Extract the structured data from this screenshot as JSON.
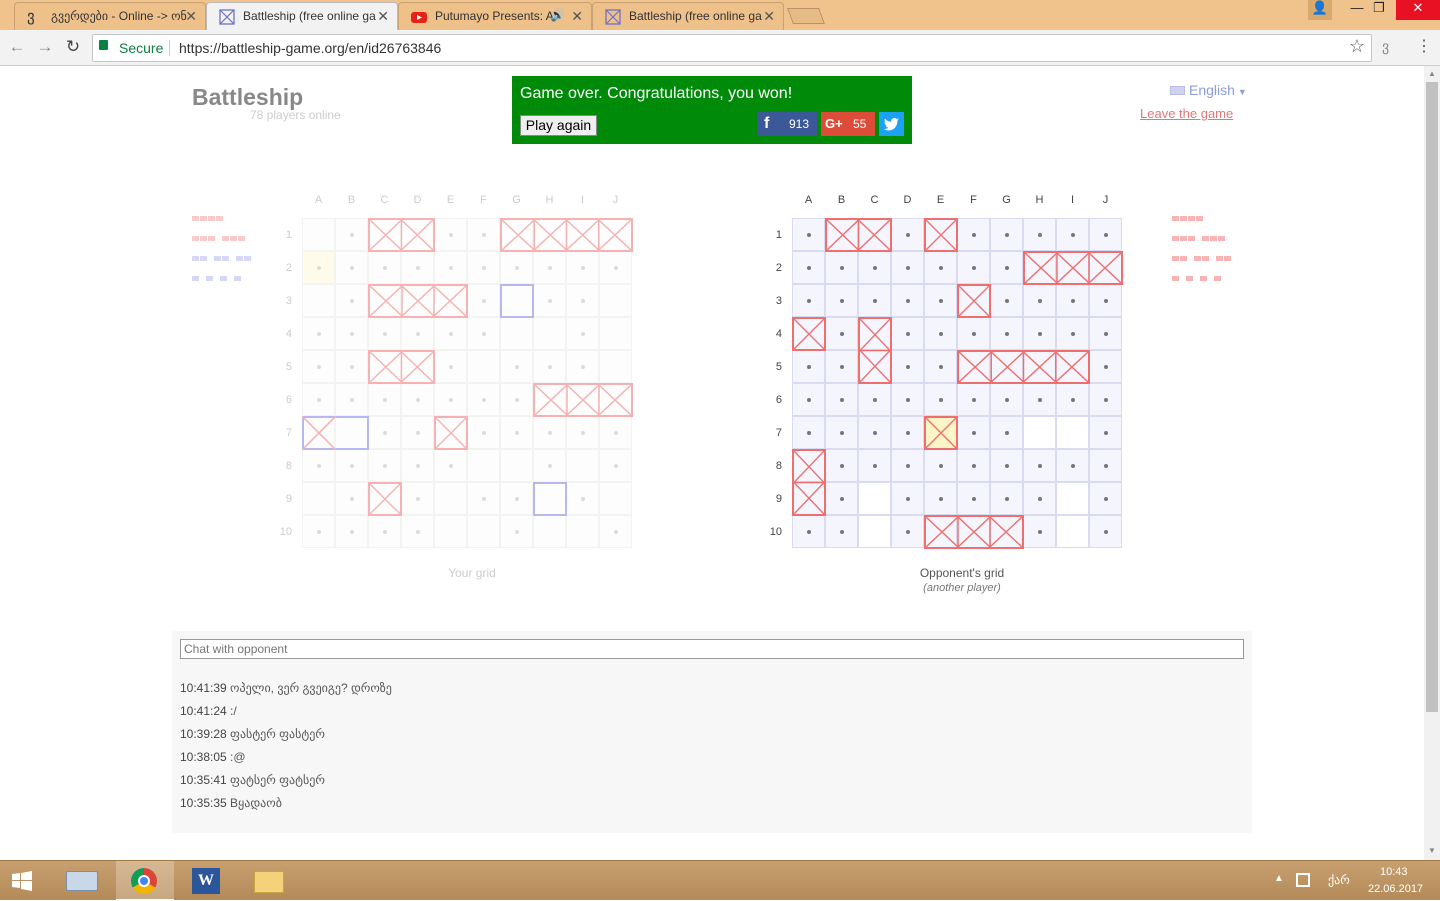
{
  "browser": {
    "tabs": [
      {
        "title": "გვერდები - Online -> ონ",
        "favicon": "georgian-letter-icon",
        "active": false
      },
      {
        "title": "Battleship (free online ga",
        "favicon": "battleship-icon",
        "active": true
      },
      {
        "title": "Putumayo Presents: A",
        "favicon": "youtube-icon",
        "active": false,
        "audio": true
      },
      {
        "title": "Battleship (free online ga",
        "favicon": "battleship-icon",
        "active": false
      }
    ],
    "secure_label": "Secure",
    "url": "https://battleship-game.org/en/id26763846"
  },
  "header": {
    "logo": "Battleship",
    "players_online": "78 players online",
    "language": "English",
    "leave_link": "Leave the game"
  },
  "banner": {
    "message": "Game over. Congratulations, you won!",
    "play_again": "Play again",
    "facebook_count": "913",
    "gplus_count": "55",
    "gplus_label": "G+"
  },
  "columns": [
    "A",
    "B",
    "C",
    "D",
    "E",
    "F",
    "G",
    "H",
    "I",
    "J"
  ],
  "rows": [
    "1",
    "2",
    "3",
    "4",
    "5",
    "6",
    "7",
    "8",
    "9",
    "10"
  ],
  "your_grid": {
    "caption": "Your grid",
    "hits": [
      [
        "C1",
        "D1"
      ],
      [
        "G1",
        "J1"
      ],
      [
        "C3",
        "E3"
      ],
      [
        "C5",
        "D5"
      ],
      [
        "H6",
        "J6"
      ],
      [
        "E7",
        "E7"
      ],
      [
        "C9",
        "C9"
      ]
    ],
    "missed_ships": [
      [
        "A7",
        "B7"
      ],
      [
        "G3",
        "G3"
      ],
      [
        "H9",
        "H9"
      ]
    ],
    "hit_cross_cells": [
      "A7"
    ],
    "dots": [
      "B1",
      "E1",
      "F1",
      "A2",
      "B2",
      "C2",
      "D2",
      "E2",
      "F2",
      "G2",
      "H2",
      "I2",
      "J2",
      "B3",
      "F3",
      "H3",
      "I3",
      "A4",
      "B4",
      "C4",
      "D4",
      "E4",
      "F4",
      "I4",
      "A5",
      "B5",
      "E5",
      "G5",
      "H5",
      "I5",
      "A6",
      "B6",
      "C6",
      "D6",
      "E6",
      "F6",
      "G6",
      "C7",
      "D7",
      "F7",
      "G7",
      "H7",
      "I7",
      "J7",
      "A8",
      "B8",
      "C8",
      "D8",
      "E8",
      "H8",
      "J8",
      "B9",
      "D9",
      "F9",
      "G9",
      "I9",
      "A10",
      "B10",
      "C10",
      "D10",
      "G10",
      "J10"
    ],
    "light_cell": "A2"
  },
  "opponent_grid": {
    "caption": "Opponent's grid",
    "subcaption": "(another player)",
    "hits": [
      [
        "B1",
        "C1"
      ],
      [
        "E1",
        "E1"
      ],
      [
        "H2",
        "J2"
      ],
      [
        "F3",
        "F3"
      ],
      [
        "A4",
        "A4"
      ],
      [
        "C4",
        "C5"
      ],
      [
        "F5",
        "I5"
      ],
      [
        "E7",
        "E7"
      ],
      [
        "A8",
        "A9"
      ],
      [
        "E10",
        "G10"
      ]
    ],
    "dots": [
      "A1",
      "D1",
      "F1",
      "G1",
      "H1",
      "I1",
      "J1",
      "A2",
      "B2",
      "C2",
      "D2",
      "E2",
      "F2",
      "G2",
      "A3",
      "B3",
      "C3",
      "D3",
      "E3",
      "G3",
      "H3",
      "I3",
      "J3",
      "B4",
      "D4",
      "E4",
      "F4",
      "G4",
      "H4",
      "I4",
      "J4",
      "A5",
      "B5",
      "D5",
      "E5",
      "J5",
      "A6",
      "B6",
      "C6",
      "D6",
      "E6",
      "F6",
      "G6",
      "H6",
      "I6",
      "J6",
      "A7",
      "B7",
      "C7",
      "D7",
      "F7",
      "G7",
      "J7",
      "B8",
      "C8",
      "D8",
      "E8",
      "F8",
      "G8",
      "H8",
      "I8",
      "J8",
      "B9",
      "D9",
      "E9",
      "F9",
      "G9",
      "H9",
      "J9",
      "A10",
      "B10",
      "D10",
      "H10",
      "J10"
    ],
    "empty_cells": [
      "C9",
      "C10",
      "H7",
      "I7",
      "I9",
      "I10"
    ],
    "highlight_cell": "E7"
  },
  "chat": {
    "placeholder": "Chat with opponent",
    "messages": [
      {
        "time": "10:41:39",
        "text": "ოპელი, ვერ გვეიგე? დროზე"
      },
      {
        "time": "10:41:24",
        "text": ":/"
      },
      {
        "time": "10:39:28",
        "text": "ფასტერ ფასტერ"
      },
      {
        "time": "10:38:05",
        "text": ":@"
      },
      {
        "time": "10:35:41",
        "text": "ფატსერ ფატსერ"
      },
      {
        "time": "10:35:35",
        "text": "Bყადაობ"
      }
    ]
  },
  "taskbar": {
    "time": "10:43",
    "date": "22.06.2017",
    "lang": "ქარ"
  },
  "colors": {
    "accent_green": "#008a0a",
    "hit_red": "#f07878",
    "miss_blue": "#b0b0f0",
    "facebook": "#3b5998",
    "gplus": "#dd4b39",
    "twitter": "#1da1f2"
  }
}
